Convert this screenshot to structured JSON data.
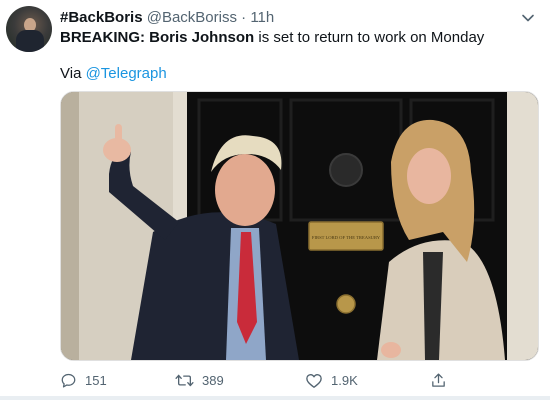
{
  "tweet": {
    "name": "#BackBoris",
    "handle": "@BackBoriss",
    "separator": "·",
    "time": "11h",
    "text_prefix": "BREAKING: ",
    "text_bold": "Boris Johnson",
    "text_rest": " is set to return to work on Monday",
    "via_label": "Via ",
    "via_link": "@Telegraph",
    "door_plaque": "FIRST LORD OF THE TREASURY",
    "replies": "151",
    "retweets": "389",
    "likes": "1.9K"
  },
  "colors": {
    "text": "#0f1419",
    "secondary": "#536471",
    "link": "#1b95e0",
    "door": "#0d0d0d",
    "brick": "#d8d2c4"
  },
  "icons": [
    "chevron-down-icon",
    "reply-icon",
    "retweet-icon",
    "like-icon",
    "share-icon"
  ]
}
